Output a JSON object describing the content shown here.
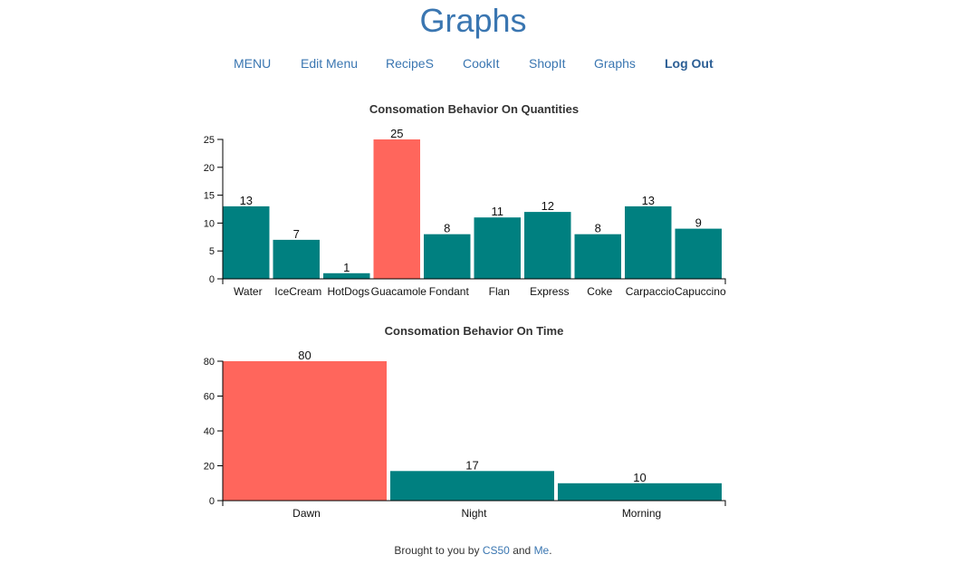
{
  "page": {
    "title": "Graphs"
  },
  "nav": {
    "items": [
      "MENU",
      "Edit Menu",
      "RecipeS",
      "CookIt",
      "ShopIt",
      "Graphs",
      "Log Out"
    ]
  },
  "colors": {
    "bar": "#008080",
    "highlight": "#ff665c",
    "link": "#3a76b1"
  },
  "footer": {
    "prefix": "Brought to you by",
    "link1": "CS50",
    "middle": "and",
    "link2": "Me",
    "suffix": "."
  },
  "chart_data": [
    {
      "type": "bar",
      "title": "Consomation Behavior On Quantities",
      "categories": [
        "Water",
        "IceCream",
        "HotDogs",
        "Guacamole",
        "Fondant",
        "Flan",
        "Express",
        "Coke",
        "Carpaccio",
        "Capuccino"
      ],
      "values": [
        13,
        7,
        1,
        25,
        8,
        11,
        12,
        8,
        13,
        9
      ],
      "highlight": "Guacamole",
      "ylim": [
        0,
        25
      ],
      "yticks": [
        0,
        5,
        10,
        15,
        20,
        25
      ],
      "grid": false
    },
    {
      "type": "bar",
      "title": "Consomation Behavior On Time",
      "categories": [
        "Dawn",
        "Night",
        "Morning"
      ],
      "values": [
        80,
        17,
        10
      ],
      "highlight": "Dawn",
      "ylim": [
        0,
        80
      ],
      "yticks": [
        0,
        20,
        40,
        60,
        80
      ],
      "grid": false
    }
  ]
}
